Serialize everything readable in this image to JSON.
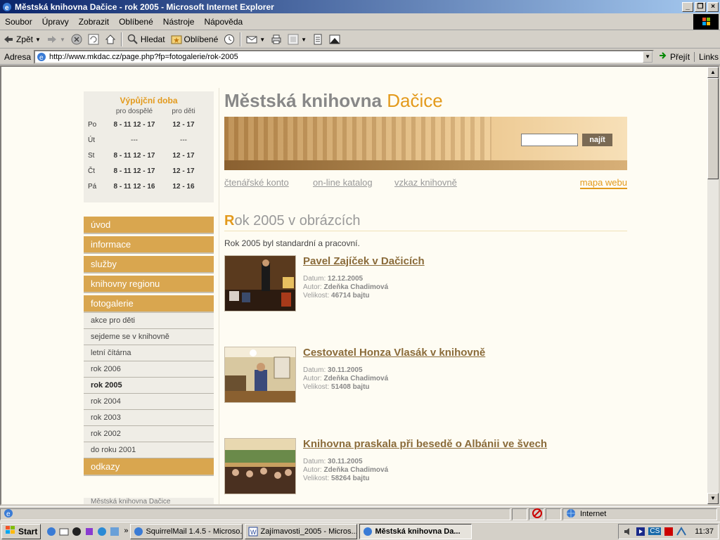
{
  "window": {
    "title": "Městská knihovna Dačice - rok 2005 - Microsoft Internet Explorer"
  },
  "menu": [
    "Soubor",
    "Úpravy",
    "Zobrazit",
    "Oblíbené",
    "Nástroje",
    "Nápověda"
  ],
  "toolbar": {
    "back": "Zpět",
    "search": "Hledat",
    "favorites": "Oblíbené"
  },
  "address": {
    "label": "Adresa",
    "url": "http://www.mkdac.cz/page.php?fp=fotogalerie/rok-2005",
    "go": "Přejít",
    "links": "Links"
  },
  "hours": {
    "title": "Výpůjční doba",
    "col_adults": "pro dospělé",
    "col_kids": "pro děti",
    "rows": [
      {
        "day": "Po",
        "adults": "8 - 11 12 - 17",
        "kids": "12 - 17"
      },
      {
        "day": "Út",
        "adults": "---",
        "kids": "---"
      },
      {
        "day": "St",
        "adults": "8 - 11 12 - 17",
        "kids": "12 - 17"
      },
      {
        "day": "Čt",
        "adults": "8 - 11 12 - 17",
        "kids": "12 - 17"
      },
      {
        "day": "Pá",
        "adults": "8 - 11 12 - 16",
        "kids": "12 - 16"
      }
    ]
  },
  "nav": {
    "main": [
      "úvod",
      "informace",
      "služby",
      "knihovny regionu",
      "fotogalerie"
    ],
    "sub": [
      "akce pro děti",
      "sejdeme se v knihovně",
      "letní čítárna",
      "rok 2006",
      "rok 2005",
      "rok 2004",
      "rok 2003",
      "rok 2002",
      "do roku 2001"
    ],
    "after": "odkazy",
    "footer": "Městská knihovna Dačice"
  },
  "brand": {
    "part1": "Městská knihovna",
    "part2": "Dačice"
  },
  "search": {
    "button": "najít"
  },
  "tools": {
    "account": "čtenářské konto",
    "catalog": "on-line katalog",
    "message": "vzkaz knihovně",
    "sitemap": "mapa webu"
  },
  "page": {
    "heading_first": "R",
    "heading_rest": "ok 2005 v obrázcích",
    "intro": "Rok 2005 byl standardní a pracovní."
  },
  "items": [
    {
      "title": "Pavel Zajíček v Dačicích",
      "date_label": "Datum:",
      "date": "12.12.2005",
      "author_label": "Autor:",
      "author": "Zdeňka Chadimová",
      "size_label": "Velikost:",
      "size": "46714 bajtu"
    },
    {
      "title": "Cestovatel Honza Vlasák v knihovně",
      "date_label": "Datum:",
      "date": "30.11.2005",
      "author_label": "Autor:",
      "author": "Zdeňka Chadimová",
      "size_label": "Velikost:",
      "size": "51408 bajtu"
    },
    {
      "title": "Knihovna praskala při besedě o Albánii ve švech",
      "date_label": "Datum:",
      "date": "30.11.2005",
      "author_label": "Autor:",
      "author": "Zdeňka Chadimová",
      "size_label": "Velikost:",
      "size": "58264 bajtu"
    }
  ],
  "status": {
    "zone": "Internet"
  },
  "taskbar": {
    "start": "Start",
    "tasks": [
      "SquirrelMail 1.4.5 - Microso...",
      "Zajímavosti_2005 - Micros...",
      "Městská knihovna Da..."
    ],
    "clock": "11:37",
    "lang": "CS"
  }
}
